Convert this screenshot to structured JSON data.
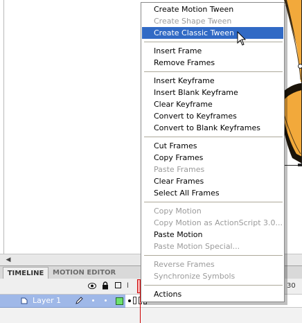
{
  "timeline": {
    "tabs": [
      "TIMELINE",
      "MOTION EDITOR"
    ],
    "header_l": "l",
    "header_30": "30",
    "layer_name": "Layer 1"
  },
  "context_menu": {
    "items": [
      {
        "label": "Create Motion Tween",
        "enabled": true
      },
      {
        "label": "Create Shape Tween",
        "enabled": false
      },
      {
        "label": "Create Classic Tween",
        "enabled": true,
        "highlighted": true
      },
      {
        "label": "Insert Frame",
        "enabled": true
      },
      {
        "label": "Remove Frames",
        "enabled": true
      },
      {
        "label": "Insert Keyframe",
        "enabled": true
      },
      {
        "label": "Insert Blank Keyframe",
        "enabled": true
      },
      {
        "label": "Clear Keyframe",
        "enabled": true
      },
      {
        "label": "Convert to Keyframes",
        "enabled": true
      },
      {
        "label": "Convert to Blank Keyframes",
        "enabled": true
      },
      {
        "label": "Cut Frames",
        "enabled": true
      },
      {
        "label": "Copy Frames",
        "enabled": true
      },
      {
        "label": "Paste Frames",
        "enabled": false
      },
      {
        "label": "Clear Frames",
        "enabled": true
      },
      {
        "label": "Select All Frames",
        "enabled": true
      },
      {
        "label": "Copy Motion",
        "enabled": false
      },
      {
        "label": "Copy Motion as ActionScript 3.0...",
        "enabled": false
      },
      {
        "label": "Paste Motion",
        "enabled": true
      },
      {
        "label": "Paste Motion Special...",
        "enabled": false
      },
      {
        "label": "Reverse Frames",
        "enabled": false
      },
      {
        "label": "Synchronize Symbols",
        "enabled": false
      },
      {
        "label": "Actions",
        "enabled": true
      }
    ]
  },
  "colors": {
    "highlight": "#316ac5",
    "layer_row": "#9fb8e8",
    "layer_color_swatch": "#6ee26e",
    "playhead": "#cc0000",
    "artwork_fill": "#f2a93b"
  }
}
